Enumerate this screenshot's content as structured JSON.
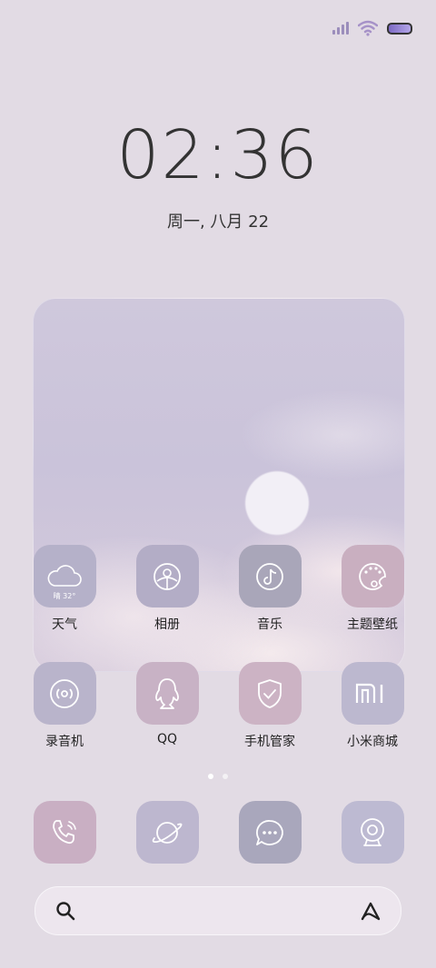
{
  "status_bar": {
    "signal": "signal-icon",
    "wifi": "wifi-icon",
    "battery": "battery-icon"
  },
  "lock": {
    "time": "02:36",
    "date": "周一, 八月 22"
  },
  "widget": {
    "weather_temp": "晴 32°"
  },
  "apps_row1": [
    {
      "label": "天气",
      "icon": "cloud-icon",
      "color": "#b5b1c9"
    },
    {
      "label": "相册",
      "icon": "gallery-icon",
      "color": "#b3adc6"
    },
    {
      "label": "音乐",
      "icon": "music-note-icon",
      "color": "#a9a6b9"
    },
    {
      "label": "主题壁纸",
      "icon": "palette-icon",
      "color": "#c9afc0"
    }
  ],
  "apps_row2": [
    {
      "label": "录音机",
      "icon": "recorder-icon",
      "color": "#b9b4cb"
    },
    {
      "label": "QQ",
      "icon": "qq-penguin-icon",
      "color": "#c8b2c5"
    },
    {
      "label": "手机管家",
      "icon": "shield-check-icon",
      "color": "#ccb3c4"
    },
    {
      "label": "小米商城",
      "icon": "mi-logo-icon",
      "color": "#bcb8cf"
    }
  ],
  "dock": [
    {
      "name": "phone",
      "icon": "phone-icon",
      "color": "#c9afc3"
    },
    {
      "name": "browser",
      "icon": "planet-icon",
      "color": "#bdb7cf"
    },
    {
      "name": "messages",
      "icon": "chat-bubble-icon",
      "color": "#a9a7bc"
    },
    {
      "name": "camera",
      "icon": "camera-icon",
      "color": "#bdbad2"
    }
  ],
  "pager": {
    "pages": 2,
    "current": 1
  },
  "search_bar": {
    "search_icon": "search-icon",
    "assistant_icon": "assistant-icon"
  }
}
